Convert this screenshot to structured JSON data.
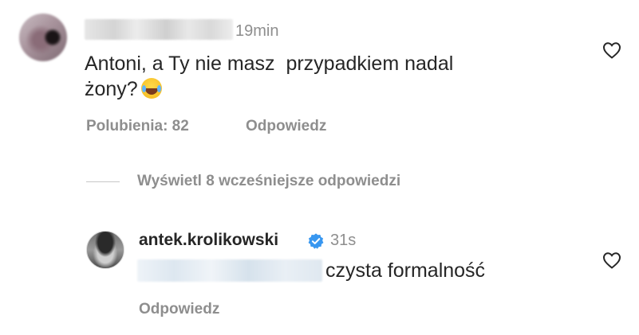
{
  "comment": {
    "time": "19min",
    "text": "Antoni, a Ty nie masz  przypadkiem nadal\nżony?",
    "emoji": "face-with-tears-of-joy",
    "likes": "Polubienia: 82",
    "reply": "Odpowiedz"
  },
  "thread": {
    "view_replies": "Wyświetl 8 wcześniejsze odpowiedzi"
  },
  "reply_comment": {
    "username": "antek.krolikowski",
    "time": "31s",
    "text": "czysta formalność",
    "reply": "Odpowiedz"
  },
  "colors": {
    "primary_text": "#262626",
    "secondary_text": "#8e8e8e",
    "verified_blue": "#3897f0"
  }
}
